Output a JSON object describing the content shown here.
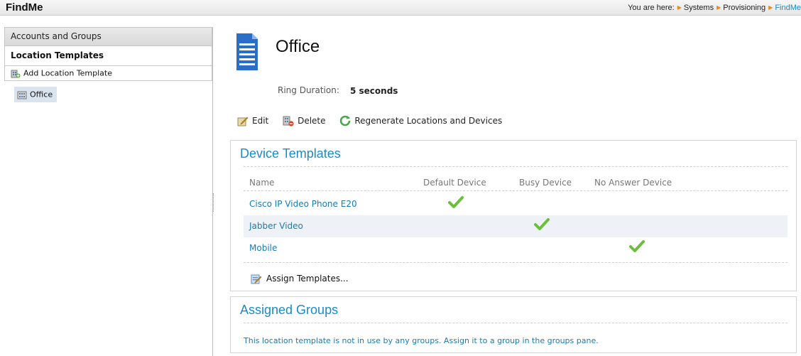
{
  "app": {
    "title": "FindMe"
  },
  "breadcrumb": {
    "prefix": "You are here:",
    "items": [
      "Systems",
      "Provisioning",
      "FindMe"
    ]
  },
  "sidebar": {
    "accounts_label": "Accounts and Groups",
    "templates_label": "Location Templates",
    "add_label": "Add Location Template",
    "tree_items": [
      {
        "label": "Office",
        "selected": true
      }
    ]
  },
  "main": {
    "title": "Office",
    "ring_label": "Ring Duration:",
    "ring_value": "5 seconds",
    "actions": {
      "edit": "Edit",
      "delete": "Delete",
      "regenerate": "Regenerate Locations and Devices"
    }
  },
  "device_templates": {
    "title": "Device Templates",
    "columns": [
      "Name",
      "Default Device",
      "Busy Device",
      "No Answer Device"
    ],
    "rows": [
      {
        "name": "Cisco IP Video Phone E20",
        "checked_column": "Default Device"
      },
      {
        "name": "Jabber Video",
        "checked_column": "Busy Device"
      },
      {
        "name": "Mobile",
        "checked_column": "No Answer Device"
      }
    ],
    "assign_label": "Assign Templates..."
  },
  "assigned_groups": {
    "title": "Assigned Groups",
    "message": "This location template is not in use by any groups. Assign it to a group in the groups pane."
  },
  "colors": {
    "accent": "#1a8bc6",
    "link": "#1a7bb4",
    "check": "#6cbf3c",
    "arrow": "#e8891d"
  }
}
